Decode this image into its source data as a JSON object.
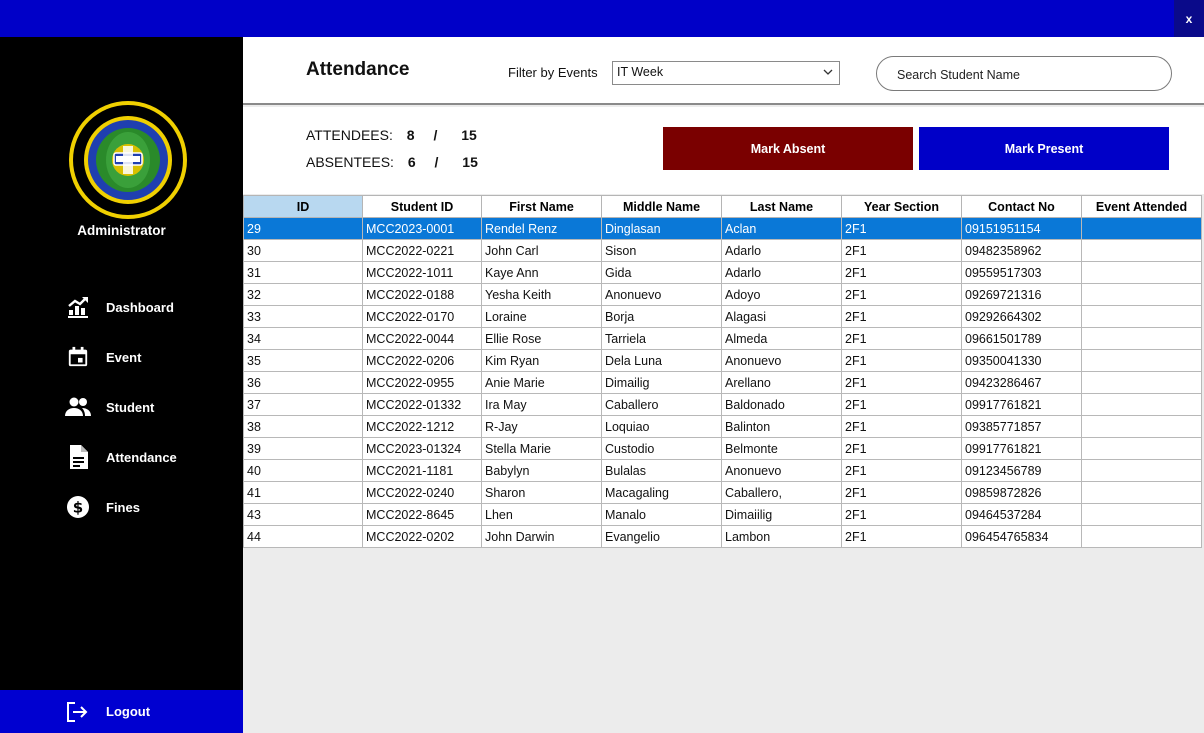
{
  "window": {
    "close_label": "x"
  },
  "colors": {
    "topbar": "#0000c8",
    "sidebar": "#000000",
    "logout_bg": "#0000d0",
    "absent_btn": "#7a0000",
    "present_btn": "#0000c8",
    "selected_row": "#0a78d7"
  },
  "sidebar": {
    "logo_icon": "information-technology-seal",
    "role": "Administrator",
    "items": [
      {
        "label": "Dashboard",
        "icon": "chart-growth-icon"
      },
      {
        "label": "Event",
        "icon": "calendar-icon"
      },
      {
        "label": "Student",
        "icon": "people-icon"
      },
      {
        "label": "Attendance",
        "icon": "document-icon"
      },
      {
        "label": "Fines",
        "icon": "dollar-icon"
      }
    ],
    "logout": {
      "label": "Logout",
      "icon": "logout-icon"
    }
  },
  "header": {
    "title": "Attendance",
    "filter_label": "Filter by Events",
    "filter_value": "IT Week",
    "search_placeholder": "Search Student Name"
  },
  "stats": {
    "attendees_label": "ATTENDEES:",
    "attendees_count": "8",
    "absentees_label": "ABSENTEES:",
    "absentees_count": "6",
    "separator": "/",
    "total": "15"
  },
  "actions": {
    "absent_label": "Mark Absent",
    "present_label": "Mark Present"
  },
  "table": {
    "columns": [
      "ID",
      "Student ID",
      "First Name",
      "Middle Name",
      "Last Name",
      "Year Section",
      "Contact No",
      "Event Attended"
    ],
    "rows": [
      [
        "29",
        "MCC2023-0001",
        "Rendel Renz",
        "Dinglasan",
        "Aclan",
        "2F1",
        "09151951154",
        ""
      ],
      [
        "30",
        "MCC2022-0221",
        "John Carl",
        "Sison",
        "Adarlo",
        "2F1",
        "09482358962",
        ""
      ],
      [
        "31",
        "MCC2022-1011",
        "Kaye Ann",
        "Gida",
        "Adarlo",
        "2F1",
        "09559517303",
        ""
      ],
      [
        "32",
        "MCC2022-0188",
        "Yesha Keith",
        "Anonuevo",
        "Adoyo",
        "2F1",
        "09269721316",
        ""
      ],
      [
        "33",
        "MCC2022-0170",
        "Loraine",
        "Borja",
        "Alagasi",
        "2F1",
        "09292664302",
        ""
      ],
      [
        "34",
        "MCC2022-0044",
        "Ellie Rose",
        "Tarriela",
        "Almeda",
        "2F1",
        "09661501789",
        ""
      ],
      [
        "35",
        "MCC2022-0206",
        "Kim Ryan",
        "Dela Luna",
        "Anonuevo",
        "2F1",
        "09350041330",
        ""
      ],
      [
        "36",
        "MCC2022-0955",
        "Anie Marie",
        "Dimailig",
        "Arellano",
        "2F1",
        "09423286467",
        ""
      ],
      [
        "37",
        "MCC2022-01332",
        "Ira May",
        "Caballero",
        "Baldonado",
        "2F1",
        "09917761821",
        ""
      ],
      [
        "38",
        "MCC2022-1212",
        "R-Jay",
        "Loquiao",
        "Balinton",
        "2F1",
        "09385771857",
        ""
      ],
      [
        "39",
        "MCC2023-01324",
        "Stella Marie",
        "Custodio",
        "Belmonte",
        "2F1",
        "09917761821",
        ""
      ],
      [
        "40",
        "MCC2021-1181",
        "Babylyn",
        "Bulalas",
        "Anonuevo",
        "2F1",
        "09123456789",
        ""
      ],
      [
        "41",
        "MCC2022-0240",
        "Sharon",
        "Macagaling",
        "Caballero,",
        "2F1",
        "09859872826",
        ""
      ],
      [
        "43",
        "MCC2022-8645",
        "Lhen",
        "Manalo",
        "Dimaiilig",
        "2F1",
        "09464537284",
        ""
      ],
      [
        "44",
        "MCC2022-0202",
        "John Darwin",
        "Evangelio",
        "Lambon",
        "2F1",
        "096454765834",
        ""
      ]
    ]
  }
}
